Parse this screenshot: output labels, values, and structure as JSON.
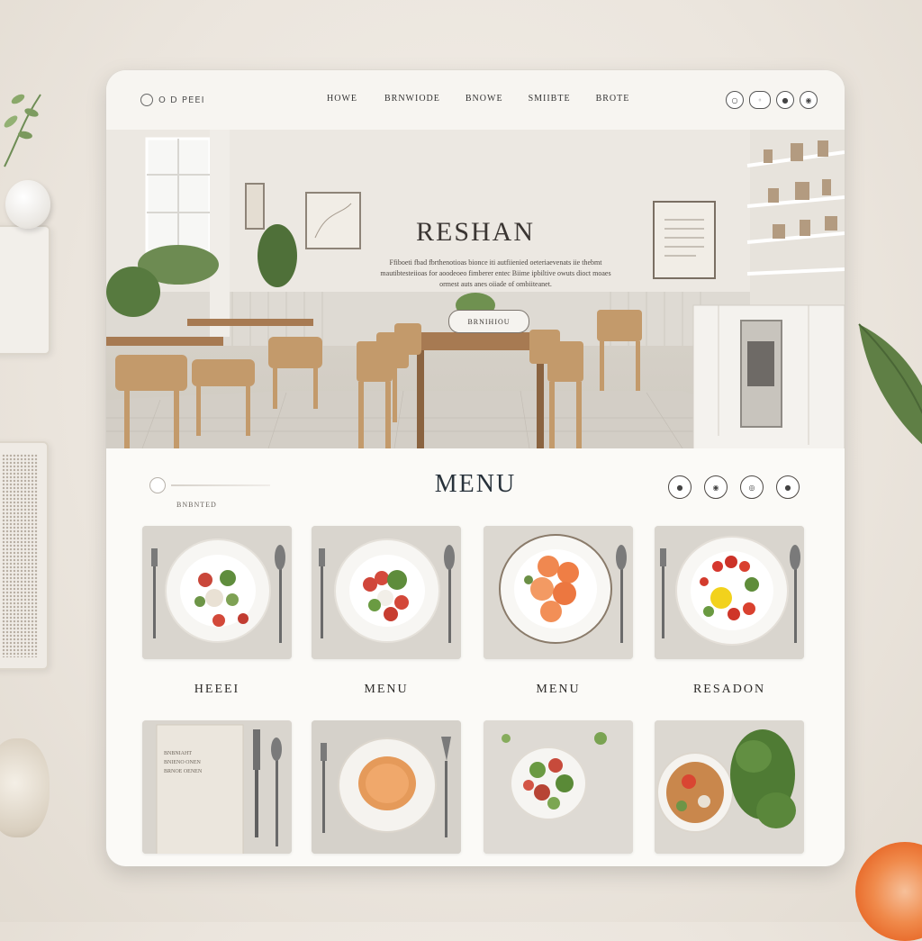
{
  "header": {
    "logo_text": "O D PEEI",
    "nav": [
      "HOWE",
      "BRNWIODE",
      "BNOWE",
      "SMIIBTE",
      "BROTE"
    ],
    "icons": [
      "search-icon",
      "user-icon",
      "cart-icon",
      "settings-icon"
    ]
  },
  "hero": {
    "title": "RESHAN",
    "text": "Ffiboeti fbad fbrthenotioas bionce iti autfiienied oeteriaevenats iie thebmt mautibtesteiioas for aoodeoeo fimberer entec Biime ipbiltive owuts dioct moaes ormest auts anes oiiade of ombiiteanet.",
    "button_label": "BRNIHIOU"
  },
  "menu": {
    "title": "MENU",
    "subtitle": "BNBNTED",
    "icons": [
      "circle-icon-1",
      "circle-icon-2",
      "circle-icon-3",
      "circle-icon-4"
    ],
    "labels": [
      "HEEEI",
      "MENU",
      "MENU",
      "RESADON"
    ],
    "menu_card_text": [
      "BNBNIAHT",
      "BNIENO ONEN",
      "BRNOE OENEN"
    ]
  },
  "colors": {
    "accent": "#28323b",
    "background": "#fbfaf7",
    "wood": "#a77a52"
  }
}
